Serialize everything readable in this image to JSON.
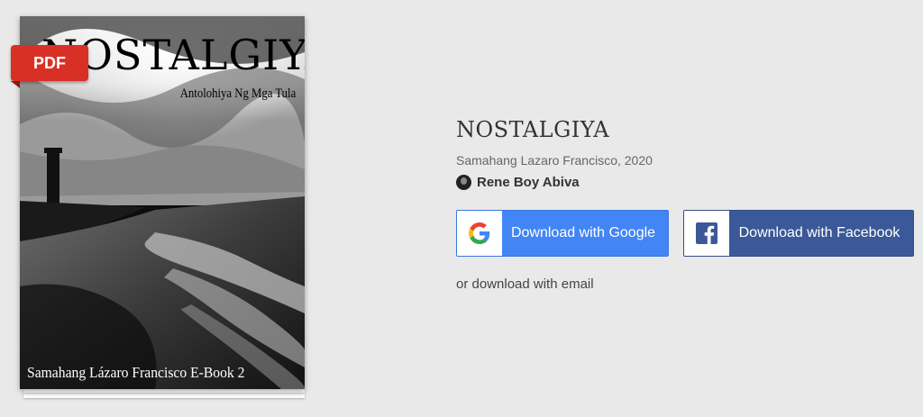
{
  "book": {
    "badge": "PDF",
    "cover_title": "NOSTALGIYA",
    "cover_subtitle": "Antolohiya Ng Mga Tula",
    "cover_footer": "Samahang Lázaro Francisco E-Book 2"
  },
  "details": {
    "title": "NOSTALGIYA",
    "publisher_year": "Samahang Lazaro Francisco, 2020",
    "author": "Rene Boy Abiva"
  },
  "actions": {
    "google_label": "Download with Google",
    "facebook_label": "Download with Facebook",
    "email_label": "or download with email"
  },
  "colors": {
    "background": "#e9e9e9",
    "google_blue": "#4285f4",
    "facebook_blue": "#3b5998",
    "pdf_red": "#d93025"
  },
  "icons": {
    "google": "google-g-icon",
    "facebook": "facebook-f-icon",
    "author": "author-avatar"
  }
}
